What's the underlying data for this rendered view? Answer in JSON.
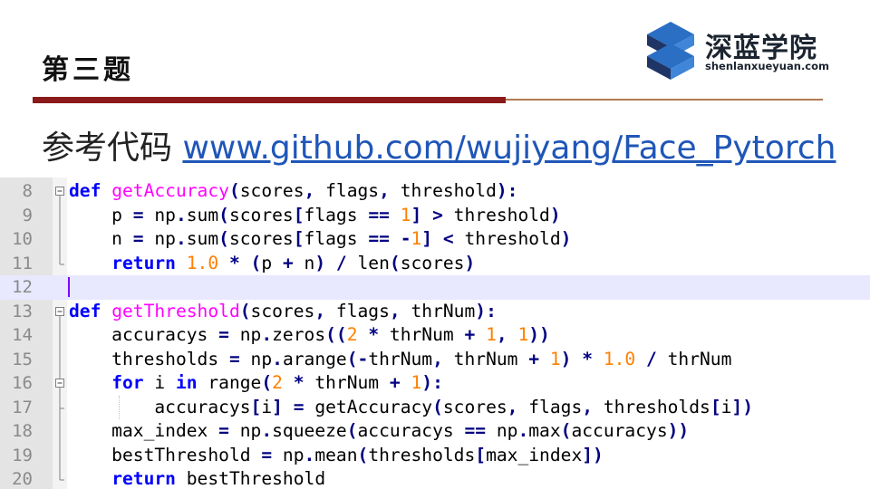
{
  "slide": {
    "title": "第三题",
    "reference_label": "参考代码 ",
    "reference_link": "www.github.com/wujiyang/Face_Pytorch"
  },
  "logo": {
    "name_cn": "深蓝学院",
    "name_en": "shenlanxueyuan.com",
    "colors": {
      "dark": "#1f3566",
      "blue": "#2a6fc4"
    }
  },
  "colors": {
    "rule_thick": "#8b1a1a",
    "rule_thin": "#b07a52",
    "link": "#1f56b8",
    "keyword": "#0000ff",
    "function": "#ff00ff",
    "number": "#ff8000",
    "operator": "#000080"
  },
  "editor": {
    "lines": [
      {
        "num": "8",
        "fold": "box-minus",
        "tokens": [
          [
            "kw",
            "def"
          ],
          [
            "t",
            " "
          ],
          [
            "fn",
            "getAccuracy"
          ],
          [
            "op",
            "("
          ],
          [
            "t",
            "scores"
          ],
          [
            "op",
            ","
          ],
          [
            "t",
            " flags"
          ],
          [
            "op",
            ","
          ],
          [
            "t",
            " threshold"
          ],
          [
            "op",
            "):"
          ]
        ]
      },
      {
        "num": "9",
        "fold": "line",
        "tokens": [
          [
            "t",
            "    p "
          ],
          [
            "op",
            "="
          ],
          [
            "t",
            " np"
          ],
          [
            "op",
            "."
          ],
          [
            "t",
            "sum"
          ],
          [
            "op",
            "("
          ],
          [
            "t",
            "scores"
          ],
          [
            "op",
            "["
          ],
          [
            "t",
            "flags "
          ],
          [
            "op",
            "=="
          ],
          [
            "t",
            " "
          ],
          [
            "num",
            "1"
          ],
          [
            "op",
            "]"
          ],
          [
            "t",
            " "
          ],
          [
            "op",
            ">"
          ],
          [
            "t",
            " threshold"
          ],
          [
            "op",
            ")"
          ]
        ]
      },
      {
        "num": "10",
        "fold": "line",
        "tokens": [
          [
            "t",
            "    n "
          ],
          [
            "op",
            "="
          ],
          [
            "t",
            " np"
          ],
          [
            "op",
            "."
          ],
          [
            "t",
            "sum"
          ],
          [
            "op",
            "("
          ],
          [
            "t",
            "scores"
          ],
          [
            "op",
            "["
          ],
          [
            "t",
            "flags "
          ],
          [
            "op",
            "=="
          ],
          [
            "t",
            " "
          ],
          [
            "op",
            "-"
          ],
          [
            "num",
            "1"
          ],
          [
            "op",
            "]"
          ],
          [
            "t",
            " "
          ],
          [
            "op",
            "<"
          ],
          [
            "t",
            " threshold"
          ],
          [
            "op",
            ")"
          ]
        ]
      },
      {
        "num": "11",
        "fold": "end",
        "tokens": [
          [
            "t",
            "    "
          ],
          [
            "kw",
            "return"
          ],
          [
            "t",
            " "
          ],
          [
            "num",
            "1.0"
          ],
          [
            "t",
            " "
          ],
          [
            "op",
            "*"
          ],
          [
            "t",
            " "
          ],
          [
            "op",
            "("
          ],
          [
            "t",
            "p "
          ],
          [
            "op",
            "+"
          ],
          [
            "t",
            " n"
          ],
          [
            "op",
            ")"
          ],
          [
            "t",
            " "
          ],
          [
            "op",
            "/"
          ],
          [
            "t",
            " len"
          ],
          [
            "op",
            "("
          ],
          [
            "t",
            "scores"
          ],
          [
            "op",
            ")"
          ]
        ]
      },
      {
        "num": "12",
        "fold": "none",
        "highlight": true,
        "cursor": true,
        "tokens": []
      },
      {
        "num": "13",
        "fold": "box-minus",
        "tokens": [
          [
            "kw",
            "def"
          ],
          [
            "t",
            " "
          ],
          [
            "fn",
            "getThreshold"
          ],
          [
            "op",
            "("
          ],
          [
            "t",
            "scores"
          ],
          [
            "op",
            ","
          ],
          [
            "t",
            " flags"
          ],
          [
            "op",
            ","
          ],
          [
            "t",
            " thrNum"
          ],
          [
            "op",
            "):"
          ]
        ]
      },
      {
        "num": "14",
        "fold": "line",
        "tokens": [
          [
            "t",
            "    accuracys "
          ],
          [
            "op",
            "="
          ],
          [
            "t",
            " np"
          ],
          [
            "op",
            "."
          ],
          [
            "t",
            "zeros"
          ],
          [
            "op",
            "(("
          ],
          [
            "num",
            "2"
          ],
          [
            "t",
            " "
          ],
          [
            "op",
            "*"
          ],
          [
            "t",
            " thrNum "
          ],
          [
            "op",
            "+"
          ],
          [
            "t",
            " "
          ],
          [
            "num",
            "1"
          ],
          [
            "op",
            ","
          ],
          [
            "t",
            " "
          ],
          [
            "num",
            "1"
          ],
          [
            "op",
            "))"
          ]
        ]
      },
      {
        "num": "15",
        "fold": "line",
        "tokens": [
          [
            "t",
            "    thresholds "
          ],
          [
            "op",
            "="
          ],
          [
            "t",
            " np"
          ],
          [
            "op",
            "."
          ],
          [
            "t",
            "arange"
          ],
          [
            "op",
            "(-"
          ],
          [
            "t",
            "thrNum"
          ],
          [
            "op",
            ","
          ],
          [
            "t",
            " thrNum "
          ],
          [
            "op",
            "+"
          ],
          [
            "t",
            " "
          ],
          [
            "num",
            "1"
          ],
          [
            "op",
            ")"
          ],
          [
            "t",
            " "
          ],
          [
            "op",
            "*"
          ],
          [
            "t",
            " "
          ],
          [
            "num",
            "1.0"
          ],
          [
            "t",
            " "
          ],
          [
            "op",
            "/"
          ],
          [
            "t",
            " thrNum"
          ]
        ]
      },
      {
        "num": "16",
        "fold": "box-minus-inner",
        "tokens": [
          [
            "t",
            "    "
          ],
          [
            "kw",
            "for"
          ],
          [
            "t",
            " i "
          ],
          [
            "kw",
            "in"
          ],
          [
            "t",
            " range"
          ],
          [
            "op",
            "("
          ],
          [
            "num",
            "2"
          ],
          [
            "t",
            " "
          ],
          [
            "op",
            "*"
          ],
          [
            "t",
            " thrNum "
          ],
          [
            "op",
            "+"
          ],
          [
            "t",
            " "
          ],
          [
            "num",
            "1"
          ],
          [
            "op",
            "):"
          ]
        ]
      },
      {
        "num": "17",
        "fold": "end-inner",
        "guide": true,
        "tokens": [
          [
            "t",
            "        accuracys"
          ],
          [
            "op",
            "["
          ],
          [
            "t",
            "i"
          ],
          [
            "op",
            "]"
          ],
          [
            "t",
            " "
          ],
          [
            "op",
            "="
          ],
          [
            "t",
            " getAccuracy"
          ],
          [
            "op",
            "("
          ],
          [
            "t",
            "scores"
          ],
          [
            "op",
            ","
          ],
          [
            "t",
            " flags"
          ],
          [
            "op",
            ","
          ],
          [
            "t",
            " thresholds"
          ],
          [
            "op",
            "["
          ],
          [
            "t",
            "i"
          ],
          [
            "op",
            "])"
          ]
        ]
      },
      {
        "num": "18",
        "fold": "line",
        "tokens": [
          [
            "t",
            "    max_index "
          ],
          [
            "op",
            "="
          ],
          [
            "t",
            " np"
          ],
          [
            "op",
            "."
          ],
          [
            "t",
            "squeeze"
          ],
          [
            "op",
            "("
          ],
          [
            "t",
            "accuracys "
          ],
          [
            "op",
            "=="
          ],
          [
            "t",
            " np"
          ],
          [
            "op",
            "."
          ],
          [
            "t",
            "max"
          ],
          [
            "op",
            "("
          ],
          [
            "t",
            "accuracys"
          ],
          [
            "op",
            "))"
          ]
        ]
      },
      {
        "num": "19",
        "fold": "line",
        "tokens": [
          [
            "t",
            "    bestThreshold "
          ],
          [
            "op",
            "="
          ],
          [
            "t",
            " np"
          ],
          [
            "op",
            "."
          ],
          [
            "t",
            "mean"
          ],
          [
            "op",
            "("
          ],
          [
            "t",
            "thresholds"
          ],
          [
            "op",
            "["
          ],
          [
            "t",
            "max_index"
          ],
          [
            "op",
            "])"
          ]
        ]
      },
      {
        "num": "20",
        "fold": "end",
        "tokens": [
          [
            "t",
            "    "
          ],
          [
            "kw",
            "return"
          ],
          [
            "t",
            " bestThreshold"
          ]
        ]
      }
    ]
  }
}
